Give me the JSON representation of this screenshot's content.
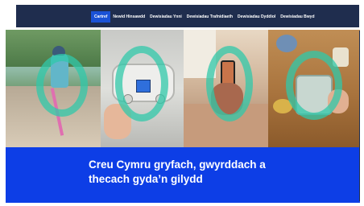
{
  "nav": {
    "items": [
      {
        "label": "Cartref",
        "active": true
      },
      {
        "label": "Newid Hinsawdd",
        "active": false
      },
      {
        "label": "Dewisiadau Ynni",
        "active": false
      },
      {
        "label": "Dewisiadau Trafnidiaeth",
        "active": false
      },
      {
        "label": "Dewisiadau Dyddiol",
        "active": false
      },
      {
        "label": "Dewisiadau Bwyd",
        "active": false
      }
    ]
  },
  "hero": {
    "panels": [
      {
        "subject": "child-on-scooter"
      },
      {
        "subject": "boiler-thermostat"
      },
      {
        "subject": "phone-photo"
      },
      {
        "subject": "food-waste-caddy"
      }
    ]
  },
  "banner": {
    "headline_line1": "Creu Cymru gryfach, gwyrddach a",
    "headline_line2": "thecach gyda’n gilydd"
  },
  "colors": {
    "header": "#1f2d4e",
    "active_nav": "#1a52d6",
    "banner": "#0d3ee6",
    "ring": "#30c8aa"
  }
}
